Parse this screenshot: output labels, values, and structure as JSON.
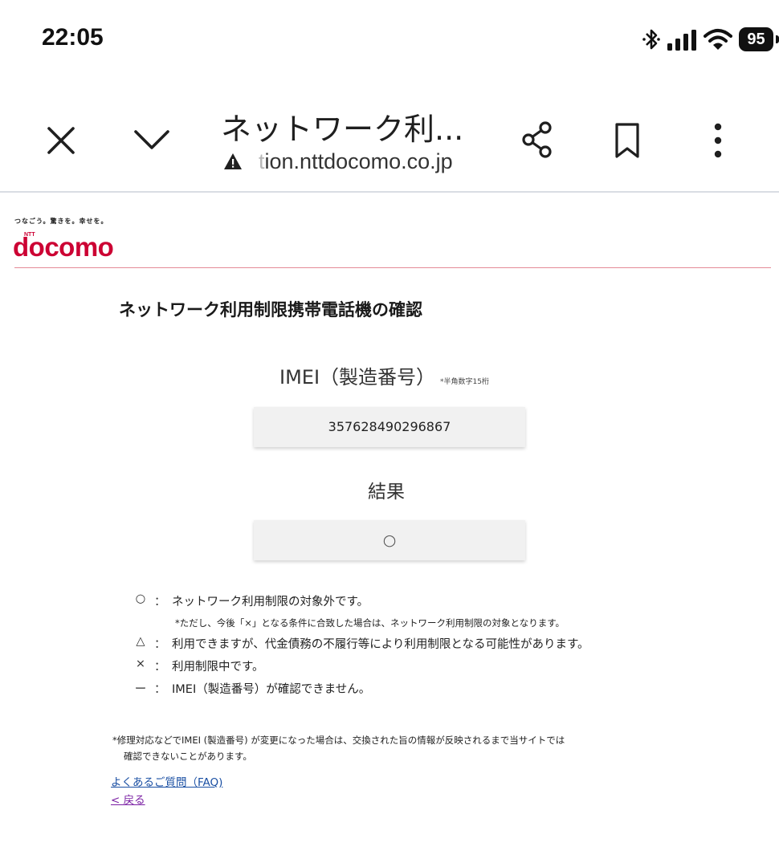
{
  "status_bar": {
    "time": "22:05",
    "battery": "95",
    "icons": [
      "bluetooth-icon",
      "signal-icon",
      "wifi-icon",
      "battery-icon"
    ]
  },
  "browser": {
    "title": "ネットワーク利...",
    "url_faded": "t",
    "url": "ion.nttdocomo.co.jp",
    "icons": [
      "close-icon",
      "chevron-down-icon",
      "warning-icon",
      "share-icon",
      "bookmark-icon",
      "more-vertical-icon"
    ]
  },
  "header": {
    "tagline": "つなごう。驚きを。幸せを。",
    "logo_text": "docomo",
    "logo_ntt": "NTT",
    "brand_color": "#cc0033"
  },
  "main": {
    "title": "ネットワーク利用制限携帯電話機の確認",
    "imei_label": "IMEI（製造番号）",
    "imei_note": "*半角数字15桁",
    "imei_value": "357628490296867",
    "result_label": "結果",
    "result_value": "○"
  },
  "legend": [
    {
      "symbol": "○",
      "colon": "：",
      "text": "ネットワーク利用制限の対象外です。",
      "sub": "*ただし、今後「×」となる条件に合致した場合は、ネットワーク利用制限の対象となります。"
    },
    {
      "symbol": "△",
      "colon": "：",
      "text": "利用できますが、代金債務の不履行等により利用制限となる可能性があります。"
    },
    {
      "symbol": "×",
      "colon": "：",
      "text": "利用制限中です。"
    },
    {
      "symbol": "ー",
      "colon": "：",
      "text": "IMEI（製造番号）が確認できません。"
    }
  ],
  "footnote": {
    "line1": "*修理対応などでIMEI (製造番号) が変更になった場合は、交換された旨の情報が反映されるまで当サイトでは",
    "line2": "確認できないことがあります。"
  },
  "links": {
    "faq": "よくあるご質問（FAQ)",
    "back": "< 戻る"
  }
}
